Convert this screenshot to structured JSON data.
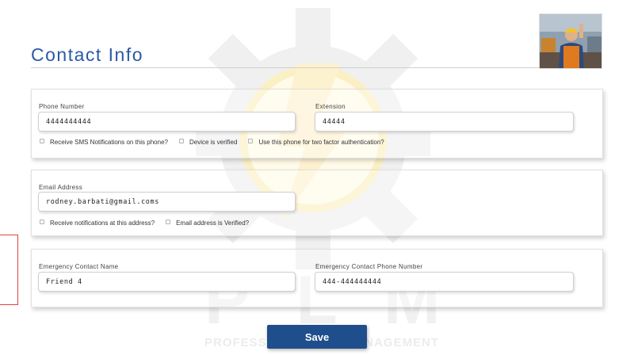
{
  "page": {
    "title": "Contact Info"
  },
  "watermark": {
    "letters": "PLM",
    "caption": "PROFESSIONAL LIFE MANAGEMENT"
  },
  "phone_section": {
    "phone_label": "Phone Number",
    "phone_value": "4444444444",
    "extension_label": "Extension",
    "extension_value": "44444",
    "sms_label": "Receive SMS Notifications on this phone?",
    "verified_label": "Device is verified",
    "two_factor_label": "Use this phone for two factor authentication?"
  },
  "email_section": {
    "email_label": "Email Address",
    "email_value": "rodney.barbati@gmail.coms",
    "notify_label": "Receive notifications at this address?",
    "verified_label": "Email address is Verified?"
  },
  "emergency_section": {
    "name_label": "Emergency Contact Name",
    "name_value": "Friend 4",
    "phone_label": "Emergency Contact Phone Number",
    "phone_value": "444-444444444"
  },
  "actions": {
    "save_label": "Save"
  },
  "colors": {
    "title": "#2a5aa5",
    "save_button": "#1f4e8c",
    "side_box_border": "#dd4444"
  }
}
